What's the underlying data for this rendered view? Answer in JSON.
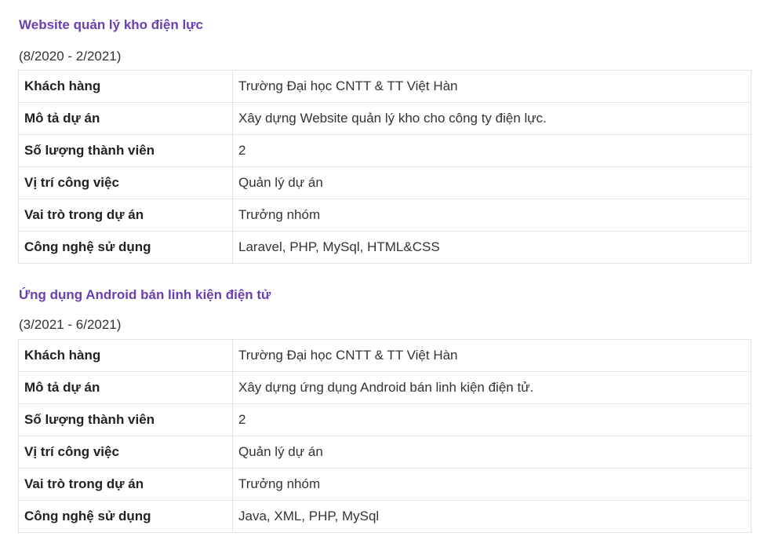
{
  "projects": [
    {
      "title": "Website quản lý kho điện lực",
      "period": "(8/2020 - 2/2021)",
      "rows": [
        {
          "label": "Khách hàng",
          "value": "Trường Đại học CNTT & TT Việt Hàn"
        },
        {
          "label": "Mô tả dự án",
          "value": "Xây dựng Website quản lý kho cho công ty điện lực."
        },
        {
          "label": "Số lượng thành viên",
          "value": "2"
        },
        {
          "label": "Vị trí công việc",
          "value": "Quản lý dự án"
        },
        {
          "label": "Vai trò trong dự án",
          "value": "Trưởng nhóm"
        },
        {
          "label": "Công nghệ sử dụng",
          "value": "Laravel, PHP, MySql, HTML&CSS"
        }
      ]
    },
    {
      "title": "Ứng dụng Android bán linh kiện điện tử",
      "period": "(3/2021 - 6/2021)",
      "rows": [
        {
          "label": "Khách hàng",
          "value": "Trường Đại học CNTT & TT Việt Hàn"
        },
        {
          "label": "Mô tả dự án",
          "value": "Xây dựng ứng dụng Android bán linh kiện điện tử."
        },
        {
          "label": "Số lượng thành viên",
          "value": "2"
        },
        {
          "label": "Vị trí công việc",
          "value": "Quản lý dự án"
        },
        {
          "label": "Vai trò trong dự án",
          "value": "Trưởng nhóm"
        },
        {
          "label": "Công nghệ sử dụng",
          "value": "Java, XML, PHP, MySql"
        }
      ]
    }
  ]
}
